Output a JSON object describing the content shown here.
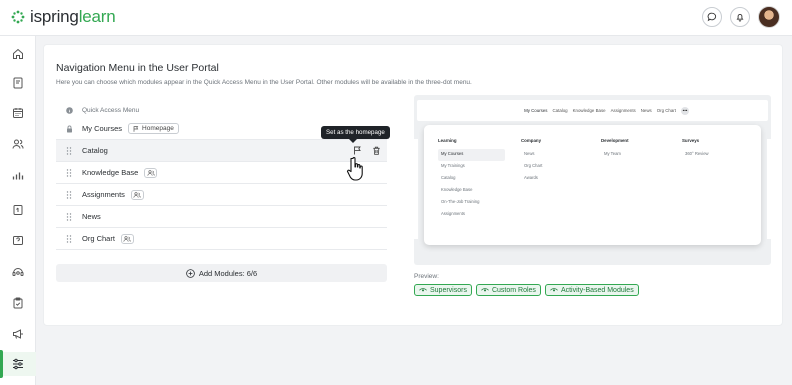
{
  "app": {
    "logo_prefix": "ispring",
    "logo_suffix": "learn"
  },
  "top_icons": [
    "chat-icon",
    "bell-icon",
    "avatar"
  ],
  "sidebar": {
    "items": [
      {
        "name": "home-icon",
        "active": false
      },
      {
        "name": "book-icon",
        "active": false
      },
      {
        "name": "calendar-icon",
        "active": false
      },
      {
        "name": "users-icon",
        "active": false
      },
      {
        "name": "reports-icon",
        "active": false
      },
      {
        "name": "document-icon",
        "active": false
      },
      {
        "name": "question-icon",
        "active": false
      },
      {
        "name": "support-icon",
        "active": false
      },
      {
        "name": "clipboard-icon",
        "active": false
      },
      {
        "name": "megaphone-icon",
        "active": false
      },
      {
        "name": "settings-sliders-icon",
        "active": true
      }
    ]
  },
  "page": {
    "title": "Navigation Menu in the User Portal",
    "subtitle": "Here you can choose which modules appear in the Quick Access Menu in the User Portal. Other modules will be available in the three-dot menu."
  },
  "modules": {
    "header": "Quick Access Menu",
    "rows": [
      {
        "label": "My Courses",
        "tag": "Homepage",
        "locked": true
      },
      {
        "label": "Catalog",
        "hover": true
      },
      {
        "label": "Knowledge Base",
        "roles_icon": true
      },
      {
        "label": "Assignments",
        "roles_icon": true
      },
      {
        "label": "News"
      },
      {
        "label": "Org Chart",
        "roles_icon": true
      }
    ],
    "tooltip": "Set as the homepage",
    "add_label": "Add Modules: 6/6"
  },
  "preview": {
    "topnav": [
      "My Courses",
      "Catalog",
      "Knowledge Base",
      "Assignments",
      "News",
      "Org Chart"
    ],
    "dots": "•••",
    "columns": [
      {
        "heading": "Learning",
        "items": [
          "My Courses",
          "My Trainings",
          "Catalog",
          "Knowledge Base",
          "On-The-Job Training",
          "Assignments"
        ]
      },
      {
        "heading": "Company",
        "items": [
          "News",
          "Org Chart",
          "Awards"
        ]
      },
      {
        "heading": "Development",
        "items": [
          "My Team"
        ]
      },
      {
        "heading": "Surveys",
        "items": [
          "360° Review"
        ]
      }
    ],
    "label": "Preview:",
    "roles": [
      "Supervisors",
      "Custom Roles",
      "Activity-Based Modules"
    ]
  },
  "colors": {
    "accent": "#33a852",
    "text": "#2b2f33",
    "muted": "#6c737a"
  }
}
